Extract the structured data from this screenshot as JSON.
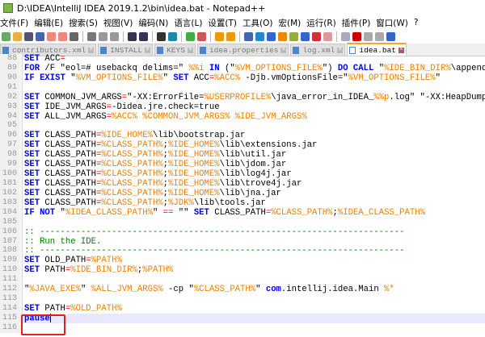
{
  "window": {
    "title": "D:\\IDEA\\IntelliJ IDEA 2019.1.2\\bin\\idea.bat - Notepad++"
  },
  "menu": [
    "文件(F)",
    "编辑(E)",
    "搜索(S)",
    "视图(V)",
    "编码(N)",
    "语言(L)",
    "设置(T)",
    "工具(O)",
    "宏(M)",
    "运行(R)",
    "插件(P)",
    "窗口(W)",
    "?"
  ],
  "toolbar_icons": [
    "new-icon",
    "open-icon",
    "save-icon",
    "save-all-icon",
    "close-icon",
    "close-all-icon",
    "print-icon",
    "cut-icon",
    "copy-icon",
    "paste-icon",
    "undo-icon",
    "redo-icon",
    "find-icon",
    "replace-icon",
    "zoom-in-icon",
    "zoom-out-icon",
    "sync-v-icon",
    "sync-h-icon",
    "wrap-icon",
    "all-chars-icon",
    "indent-guide-icon",
    "udl-icon",
    "doc-map-icon",
    "func-list-icon",
    "folder-icon",
    "monitor-icon",
    "record-icon",
    "stop-icon",
    "play-icon",
    "run-multi-icon",
    "save-macro-icon"
  ],
  "tabs": [
    {
      "label": "contributors.xml",
      "active": false
    },
    {
      "label": "INSTALL",
      "active": false
    },
    {
      "label": "KEYS",
      "active": false
    },
    {
      "label": "idea.properties",
      "active": false
    },
    {
      "label": "log.xml",
      "active": false
    },
    {
      "label": "idea.bat",
      "active": true
    }
  ],
  "editor": {
    "current_line": 115,
    "lines": [
      {
        "n": "88",
        "seg": [
          [
            "kw",
            "SET"
          ],
          [
            "txt",
            " ACC"
          ],
          [
            "op",
            "="
          ]
        ]
      },
      {
        "n": "89",
        "seg": [
          [
            "kw",
            "FOR"
          ],
          [
            "txt",
            " /F \"eol=# usebackq delims=\" "
          ],
          [
            "var",
            "%%i"
          ],
          [
            "txt",
            " "
          ],
          [
            "kw",
            "IN"
          ],
          [
            "txt",
            " (\""
          ],
          [
            "var",
            "%VM_OPTIONS_FILE%"
          ],
          [
            "txt",
            "\") "
          ],
          [
            "kw",
            "DO"
          ],
          [
            "txt",
            " "
          ],
          [
            "kw",
            "CALL"
          ],
          [
            "txt",
            " \""
          ],
          [
            "var",
            "%IDE_BIN_DIR%"
          ],
          [
            "txt",
            "\\append.bat\""
          ]
        ]
      },
      {
        "n": "90",
        "seg": [
          [
            "kw",
            "IF EXIST"
          ],
          [
            "txt",
            " \""
          ],
          [
            "var",
            "%VM_OPTIONS_FILE%"
          ],
          [
            "txt",
            "\" "
          ],
          [
            "kw",
            "SET"
          ],
          [
            "txt",
            " ACC"
          ],
          [
            "op",
            "="
          ],
          [
            "var",
            "%ACC%"
          ],
          [
            "txt",
            " -Djb.vmOptionsFile=\""
          ],
          [
            "var",
            "%VM_OPTIONS_FILE%"
          ],
          [
            "txt",
            "\""
          ]
        ]
      },
      {
        "n": "91",
        "seg": []
      },
      {
        "n": "92",
        "seg": [
          [
            "kw",
            "SET"
          ],
          [
            "txt",
            " COMMON_JVM_ARGS"
          ],
          [
            "op",
            "="
          ],
          [
            "txt",
            "\"-XX:ErrorFile="
          ],
          [
            "var",
            "%USERPROFILE%"
          ],
          [
            "txt",
            "\\java_error_in_IDEA_"
          ],
          [
            "var",
            "%%p"
          ],
          [
            "txt",
            ".log\" \"-XX:HeapDumpPath="
          ]
        ]
      },
      {
        "n": "93",
        "seg": [
          [
            "kw",
            "SET"
          ],
          [
            "txt",
            " IDE_JVM_ARGS"
          ],
          [
            "op",
            "="
          ],
          [
            "txt",
            "-Didea.jre.check=true"
          ]
        ]
      },
      {
        "n": "94",
        "seg": [
          [
            "kw",
            "SET"
          ],
          [
            "txt",
            " ALL_JVM_ARGS"
          ],
          [
            "op",
            "="
          ],
          [
            "var",
            "%ACC%"
          ],
          [
            "txt",
            " "
          ],
          [
            "var",
            "%COMMON_JVM_ARGS%"
          ],
          [
            "txt",
            " "
          ],
          [
            "var",
            "%IDE_JVM_ARGS%"
          ]
        ]
      },
      {
        "n": "95",
        "seg": []
      },
      {
        "n": "96",
        "seg": [
          [
            "kw",
            "SET"
          ],
          [
            "txt",
            " CLASS_PATH"
          ],
          [
            "op",
            "="
          ],
          [
            "var",
            "%IDE_HOME%"
          ],
          [
            "txt",
            "\\lib\\bootstrap.jar"
          ]
        ]
      },
      {
        "n": "97",
        "seg": [
          [
            "kw",
            "SET"
          ],
          [
            "txt",
            " CLASS_PATH"
          ],
          [
            "op",
            "="
          ],
          [
            "var",
            "%CLASS_PATH%"
          ],
          [
            "txt",
            ";"
          ],
          [
            "var",
            "%IDE_HOME%"
          ],
          [
            "txt",
            "\\lib\\extensions.jar"
          ]
        ]
      },
      {
        "n": "98",
        "seg": [
          [
            "kw",
            "SET"
          ],
          [
            "txt",
            " CLASS_PATH"
          ],
          [
            "op",
            "="
          ],
          [
            "var",
            "%CLASS_PATH%"
          ],
          [
            "txt",
            ";"
          ],
          [
            "var",
            "%IDE_HOME%"
          ],
          [
            "txt",
            "\\lib\\util.jar"
          ]
        ]
      },
      {
        "n": "99",
        "seg": [
          [
            "kw",
            "SET"
          ],
          [
            "txt",
            " CLASS_PATH"
          ],
          [
            "op",
            "="
          ],
          [
            "var",
            "%CLASS_PATH%"
          ],
          [
            "txt",
            ";"
          ],
          [
            "var",
            "%IDE_HOME%"
          ],
          [
            "txt",
            "\\lib\\jdom.jar"
          ]
        ]
      },
      {
        "n": "100",
        "seg": [
          [
            "kw",
            "SET"
          ],
          [
            "txt",
            " CLASS_PATH"
          ],
          [
            "op",
            "="
          ],
          [
            "var",
            "%CLASS_PATH%"
          ],
          [
            "txt",
            ";"
          ],
          [
            "var",
            "%IDE_HOME%"
          ],
          [
            "txt",
            "\\lib\\log4j.jar"
          ]
        ]
      },
      {
        "n": "101",
        "seg": [
          [
            "kw",
            "SET"
          ],
          [
            "txt",
            " CLASS_PATH"
          ],
          [
            "op",
            "="
          ],
          [
            "var",
            "%CLASS_PATH%"
          ],
          [
            "txt",
            ";"
          ],
          [
            "var",
            "%IDE_HOME%"
          ],
          [
            "txt",
            "\\lib\\trove4j.jar"
          ]
        ]
      },
      {
        "n": "102",
        "seg": [
          [
            "kw",
            "SET"
          ],
          [
            "txt",
            " CLASS_PATH"
          ],
          [
            "op",
            "="
          ],
          [
            "var",
            "%CLASS_PATH%"
          ],
          [
            "txt",
            ";"
          ],
          [
            "var",
            "%IDE_HOME%"
          ],
          [
            "txt",
            "\\lib\\jna.jar"
          ]
        ]
      },
      {
        "n": "103",
        "seg": [
          [
            "kw",
            "SET"
          ],
          [
            "txt",
            " CLASS_PATH"
          ],
          [
            "op",
            "="
          ],
          [
            "var",
            "%CLASS_PATH%"
          ],
          [
            "txt",
            ";"
          ],
          [
            "var",
            "%JDK%"
          ],
          [
            "txt",
            "\\lib\\tools.jar"
          ]
        ]
      },
      {
        "n": "104",
        "seg": [
          [
            "kw",
            "IF NOT"
          ],
          [
            "txt",
            " \""
          ],
          [
            "var",
            "%IDEA_CLASS_PATH%"
          ],
          [
            "txt",
            "\" "
          ],
          [
            "op",
            "=="
          ],
          [
            "txt",
            " \"\" "
          ],
          [
            "kw",
            "SET"
          ],
          [
            "txt",
            " CLASS_PATH"
          ],
          [
            "op",
            "="
          ],
          [
            "var",
            "%CLASS_PATH%"
          ],
          [
            "txt",
            ";"
          ],
          [
            "var",
            "%IDEA_CLASS_PATH%"
          ]
        ]
      },
      {
        "n": "105",
        "seg": []
      },
      {
        "n": "106",
        "seg": [
          [
            "cm",
            ":: -----------------------------------------------------------------------"
          ]
        ]
      },
      {
        "n": "107",
        "seg": [
          [
            "cm",
            ":: Run the IDE."
          ]
        ]
      },
      {
        "n": "108",
        "seg": [
          [
            "cm",
            ":: -----------------------------------------------------------------------"
          ]
        ]
      },
      {
        "n": "109",
        "seg": [
          [
            "kw",
            "SET"
          ],
          [
            "txt",
            " OLD_PATH"
          ],
          [
            "op",
            "="
          ],
          [
            "var",
            "%PATH%"
          ]
        ]
      },
      {
        "n": "110",
        "seg": [
          [
            "kw",
            "SET"
          ],
          [
            "txt",
            " PATH"
          ],
          [
            "op",
            "="
          ],
          [
            "var",
            "%IDE_BIN_DIR%"
          ],
          [
            "txt",
            ";"
          ],
          [
            "var",
            "%PATH%"
          ]
        ]
      },
      {
        "n": "111",
        "seg": []
      },
      {
        "n": "112",
        "seg": [
          [
            "txt",
            "\""
          ],
          [
            "var",
            "%JAVA_EXE%"
          ],
          [
            "txt",
            "\" "
          ],
          [
            "var",
            "%ALL_JVM_ARGS%"
          ],
          [
            "txt",
            " -cp \""
          ],
          [
            "var",
            "%CLASS_PATH%"
          ],
          [
            "txt",
            "\" "
          ],
          [
            "kw",
            "com"
          ],
          [
            "txt",
            ".intellij.idea.Main "
          ],
          [
            "var",
            "%*"
          ]
        ]
      },
      {
        "n": "113",
        "seg": []
      },
      {
        "n": "114",
        "seg": [
          [
            "kw",
            "SET"
          ],
          [
            "txt",
            " PATH"
          ],
          [
            "op",
            "="
          ],
          [
            "var",
            "%OLD_PATH%"
          ]
        ]
      },
      {
        "n": "115",
        "seg": [
          [
            "kw",
            "pause"
          ]
        ]
      },
      {
        "n": "116",
        "seg": []
      }
    ]
  }
}
